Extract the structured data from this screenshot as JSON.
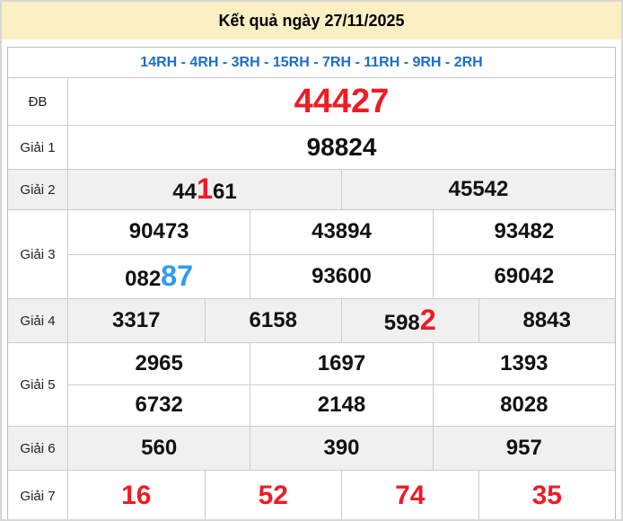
{
  "page": {
    "title": "Kết quả ngày 27/11/2025",
    "subtitle": "14RH - 4RH - 3RH - 15RH - 7RH - 11RH - 9RH - 2RH"
  },
  "colors": {
    "banner_bg": "#FBF0C4",
    "stripe_bg": "#F0F0F0",
    "red": "#EE1C25",
    "highlight_blue": "#2F9BF1",
    "subtitle_blue": "#1B6EC8",
    "border": "#CCCCCC"
  },
  "results": {
    "rows": [
      {
        "key": "db",
        "label": "ĐB",
        "stripe": false,
        "lines": [
          [
            [
              {
                "t": "44427"
              }
            ]
          ]
        ]
      },
      {
        "key": "g1",
        "label": "Giải 1",
        "stripe": false,
        "lines": [
          [
            [
              {
                "t": "98824"
              }
            ]
          ]
        ]
      },
      {
        "key": "g2",
        "label": "Giải 2",
        "stripe": true,
        "lines": [
          [
            [
              {
                "t": "44"
              },
              {
                "t": "1",
                "hl": "red"
              },
              {
                "t": "61"
              }
            ],
            [
              {
                "t": "45542"
              }
            ]
          ]
        ]
      },
      {
        "key": "g3",
        "label": "Giải 3",
        "stripe": false,
        "lines": [
          [
            [
              {
                "t": "90473"
              }
            ],
            [
              {
                "t": "43894"
              }
            ],
            [
              {
                "t": "93482"
              }
            ]
          ],
          [
            [
              {
                "t": "082"
              },
              {
                "t": "87",
                "hl": "blue"
              }
            ],
            [
              {
                "t": "93600"
              }
            ],
            [
              {
                "t": "69042"
              }
            ]
          ]
        ]
      },
      {
        "key": "g4",
        "label": "Giải 4",
        "stripe": true,
        "lines": [
          [
            [
              {
                "t": "3317"
              }
            ],
            [
              {
                "t": "6158"
              }
            ],
            [
              {
                "t": "598"
              },
              {
                "t": "2",
                "hl": "red"
              }
            ],
            [
              {
                "t": "8843"
              }
            ]
          ]
        ]
      },
      {
        "key": "g5",
        "label": "Giải 5",
        "stripe": false,
        "lines": [
          [
            [
              {
                "t": "2965"
              }
            ],
            [
              {
                "t": "1697"
              }
            ],
            [
              {
                "t": "1393"
              }
            ]
          ],
          [
            [
              {
                "t": "6732"
              }
            ],
            [
              {
                "t": "2148"
              }
            ],
            [
              {
                "t": "8028"
              }
            ]
          ]
        ]
      },
      {
        "key": "g6",
        "label": "Giải 6",
        "stripe": true,
        "lines": [
          [
            [
              {
                "t": "560"
              }
            ],
            [
              {
                "t": "390"
              }
            ],
            [
              {
                "t": "957"
              }
            ]
          ]
        ]
      },
      {
        "key": "g7",
        "label": "Giải 7",
        "stripe": false,
        "lines": [
          [
            [
              {
                "t": "16"
              }
            ],
            [
              {
                "t": "52"
              }
            ],
            [
              {
                "t": "74"
              }
            ],
            [
              {
                "t": "35"
              }
            ]
          ]
        ]
      }
    ]
  }
}
